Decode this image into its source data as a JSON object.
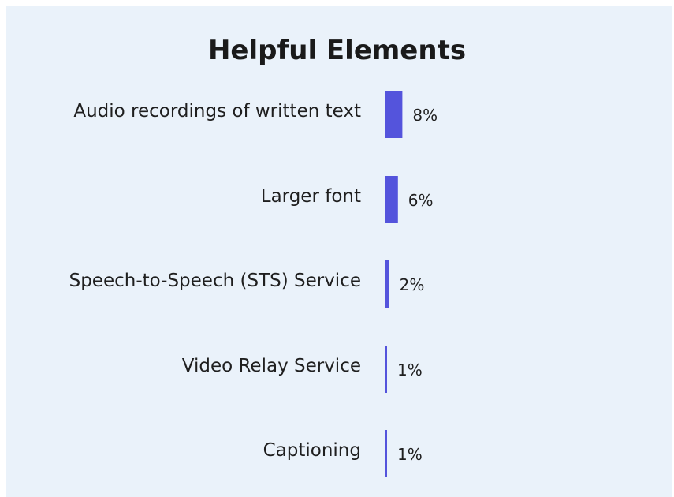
{
  "chart_data": {
    "type": "bar",
    "orientation": "horizontal",
    "title": "Helpful Elements",
    "categories": [
      "Audio recordings of written text",
      "Larger font",
      "Speech-to-Speech (STS) Service",
      "Video Relay Service",
      "Captioning"
    ],
    "values": [
      8,
      6,
      2,
      1,
      1
    ],
    "value_labels": [
      "8%",
      "6%",
      "2%",
      "1%",
      "1%"
    ],
    "unit": "%",
    "bar_color": "#5454dc",
    "grid": false,
    "legend": "none"
  }
}
